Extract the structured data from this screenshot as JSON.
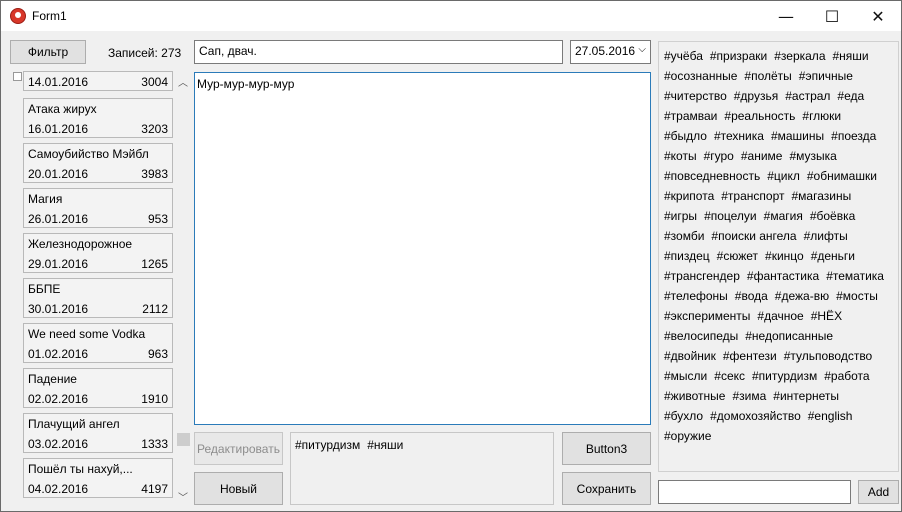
{
  "window": {
    "title": "Form1",
    "minimize_glyph": "—",
    "maximize_glyph": "☐",
    "close_glyph": "✕"
  },
  "toolbar": {
    "filter_label": "Фильтр",
    "records_label": "Записей: 273"
  },
  "record": {
    "title_value": "Сап, двач.",
    "date_value": "27.05.2016",
    "body_text": "Мур-мур-мур-мур",
    "current_tags": [
      "#питурдизм",
      "#няши"
    ]
  },
  "buttons": {
    "edit": "Редактировать",
    "new": "Новый",
    "button3": "Button3",
    "save": "Сохранить",
    "add": "Add"
  },
  "list": {
    "partial_item": {
      "date": "14.01.2016",
      "count": "3004"
    },
    "items": [
      {
        "name": "Атака жирух",
        "date": "16.01.2016",
        "count": "3203"
      },
      {
        "name": "Самоубийство Мэйбл",
        "date": "20.01.2016",
        "count": "3983"
      },
      {
        "name": "Магия",
        "date": "26.01.2016",
        "count": "953"
      },
      {
        "name": "Железнодорожное",
        "date": "29.01.2016",
        "count": "1265"
      },
      {
        "name": "ББПЕ",
        "date": "30.01.2016",
        "count": "2112"
      },
      {
        "name": "We need some Vodka",
        "date": "01.02.2016",
        "count": "963"
      },
      {
        "name": "Падение",
        "date": "02.02.2016",
        "count": "1910"
      },
      {
        "name": "Плачущий ангел",
        "date": "03.02.2016",
        "count": "1333"
      },
      {
        "name": "Пошёл ты нахуй,...",
        "date": "04.02.2016",
        "count": "4197"
      }
    ]
  },
  "tag_rows": [
    [
      "#учёба",
      "#призраки",
      "#зеркала",
      "#няши"
    ],
    [
      "#осознанные",
      "#полёты",
      "#эпичные"
    ],
    [
      "#читерство",
      "#друзья",
      "#астрал",
      "#еда"
    ],
    [
      "#трамваи",
      "#реальность",
      "#глюки"
    ],
    [
      "#быдло",
      "#техника",
      "#машины",
      "#поезда"
    ],
    [
      "#коты",
      "#гуро",
      "#аниме",
      "#музыка"
    ],
    [
      "#повседневность",
      "#цикл",
      "#обнимашки"
    ],
    [
      "#крипота",
      "#транспорт",
      "#магазины"
    ],
    [
      "#игры",
      "#поцелуи",
      "#магия",
      "#боёвка"
    ],
    [
      "#зомби",
      "#поиски ангела",
      "#лифты"
    ],
    [
      "#пиздец",
      "#сюжет",
      "#кинцо",
      "#деньги"
    ],
    [
      "#трансгендер",
      "#фантастика",
      "#тематика"
    ],
    [
      "#телефоны",
      "#вода",
      "#дежа-вю",
      "#мосты"
    ],
    [
      "#эксперименты",
      "#дачное",
      "#НЁХ"
    ],
    [
      "#велосипеды",
      "#недописанные"
    ],
    [
      "#двойник",
      "#фентези",
      "#тульповодство"
    ],
    [
      "#мысли",
      "#секс",
      "#питурдизм",
      "#работа"
    ],
    [
      "#животные",
      "#зима",
      "#интернеты"
    ],
    [
      "#бухло",
      "#домохозяйство",
      "#english"
    ],
    [
      "#оружие"
    ]
  ],
  "new_tag_value": "",
  "icons": {
    "app": "app-icon",
    "dropdown": "chevron-down-icon",
    "scroll_up": "scroll-up-icon",
    "scroll_down": "scroll-down-icon"
  }
}
